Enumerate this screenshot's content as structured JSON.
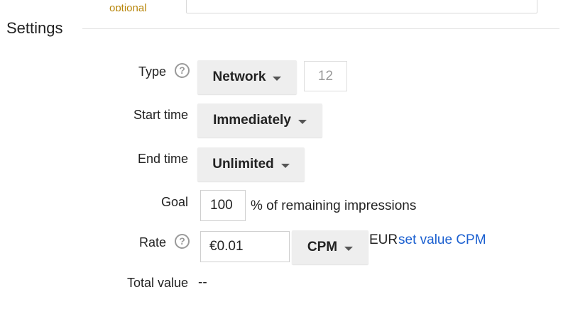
{
  "top_row": {
    "label": "optional"
  },
  "section": {
    "title": "Settings"
  },
  "type": {
    "label": "Type",
    "help_icon": "help-circle-icon",
    "help_glyph": "?",
    "dropdown_value": "Network",
    "number_value": "12"
  },
  "start_time": {
    "label": "Start time",
    "dropdown_value": "Immediately"
  },
  "end_time": {
    "label": "End time",
    "dropdown_value": "Unlimited"
  },
  "goal": {
    "label": "Goal",
    "value": "100",
    "suffix": "% of remaining impressions"
  },
  "rate": {
    "label": "Rate",
    "help_icon": "help-circle-icon",
    "help_glyph": "?",
    "value": "€0.01",
    "unit_value": "CPM",
    "currency": "EUR",
    "link_text": "set value CPM"
  },
  "total_value": {
    "label": "Total value",
    "value": "--"
  },
  "colors": {
    "link": "#1a5fd0",
    "dropdown_bg": "#eeeeee",
    "optional_label": "#b8860b",
    "divider": "#e5e5e5"
  }
}
